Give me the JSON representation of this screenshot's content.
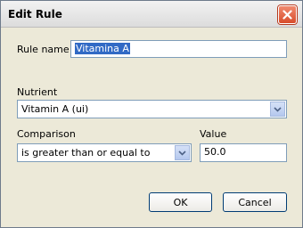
{
  "window": {
    "title": "Edit Rule"
  },
  "rule_name": {
    "label": "Rule name",
    "value": "Vitamina A"
  },
  "nutrient": {
    "label": "Nutrient",
    "selected": "Vitamin A (ui)"
  },
  "comparison": {
    "label": "Comparison",
    "selected": "is greater than or equal to"
  },
  "value_field": {
    "label": "Value",
    "value": "50.0"
  },
  "buttons": {
    "ok": "OK",
    "cancel": "Cancel"
  },
  "icons": {
    "close": "close-icon",
    "dropdown": "chevron-down-icon"
  },
  "colors": {
    "close_button": "#d84d2c",
    "selection": "#316ac5",
    "field_border": "#7f9db9",
    "dialog_bg": "#ece9d8"
  }
}
